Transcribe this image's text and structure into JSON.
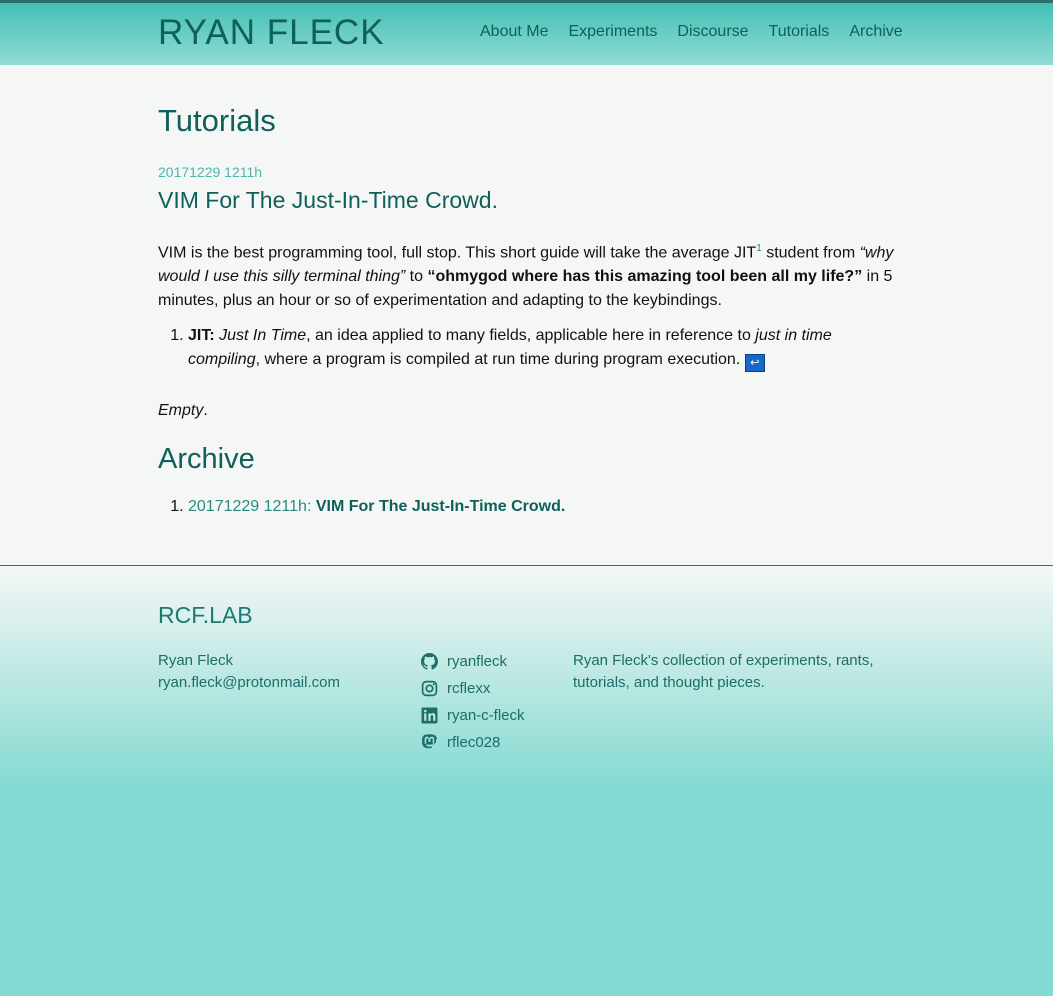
{
  "header": {
    "site_title": "RYAN FLECK",
    "nav": [
      "About Me",
      "Experiments",
      "Discourse",
      "Tutorials",
      "Archive"
    ]
  },
  "main": {
    "page_title": "Tutorials",
    "post": {
      "date": "20171229 1211h",
      "title": "VIM For The Just-In-Time Crowd.",
      "intro_part1": "VIM is the best programming tool, full stop. This short guide will take the average JIT",
      "footnote_ref": "1",
      "intro_part2": " student from ",
      "intro_em": "“why would I use this silly terminal thing”",
      "intro_part3": " to ",
      "intro_strong": "“ohmygod where has this amazing tool been all my life?”",
      "intro_part4": " in 5 minutes, plus an hour or so of experimentation and adapting to the keybindings.",
      "footnote": {
        "term": "JIT:",
        "em1": "Just In Time",
        "text1": ", an idea applied to many fields, applicable here in reference to ",
        "em2": "just in time compiling",
        "text2": ", where a program is compiled at run time during program execution. ",
        "backref_symbol": "↩"
      }
    },
    "empty_text": "Empty",
    "archive_title": "Archive",
    "archive_items": [
      {
        "date": "20171229 1211h",
        "sep": ": ",
        "title": "VIM For The Just-In-Time Crowd."
      }
    ]
  },
  "footer": {
    "brand": "RCF.LAB",
    "name": "Ryan Fleck",
    "email": "ryan.fleck@protonmail.com",
    "socials": [
      {
        "icon": "github-icon",
        "handle": "ryanfleck"
      },
      {
        "icon": "instagram-icon",
        "handle": "rcflexx"
      },
      {
        "icon": "linkedin-icon",
        "handle": "ryan-c-fleck"
      },
      {
        "icon": "mastodon-icon",
        "handle": "rflec028"
      }
    ],
    "description": "Ryan Fleck's collection of experiments, rants, tutorials, and thought pieces."
  }
}
